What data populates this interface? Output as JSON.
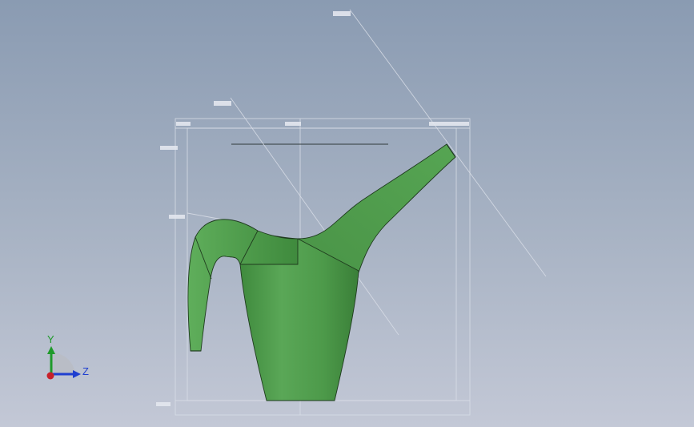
{
  "view": {
    "background_top": "#8a9bb2",
    "background_bottom": "#c3c8d6",
    "model_color": "#4f9a4c",
    "model_edge_color": "#1f3b1e"
  },
  "triad": {
    "y_label": "Y",
    "z_label": "Z",
    "y_color": "#1f9a2a",
    "z_color": "#1f3fd0",
    "x_color": "#c8202a"
  }
}
